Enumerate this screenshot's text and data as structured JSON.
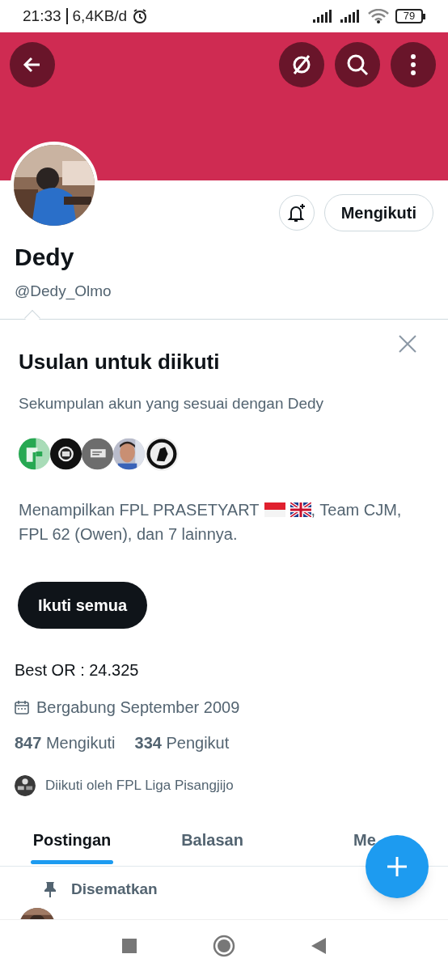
{
  "status_bar": {
    "time": "21:33",
    "speed": "6,4KB/d",
    "battery": "79"
  },
  "header": {
    "buttons": [
      {
        "kind": "back"
      },
      {
        "kind": "grok"
      },
      {
        "kind": "search"
      },
      {
        "kind": "more"
      }
    ]
  },
  "profile": {
    "name": "Dedy",
    "handle": "@Dedy_Olmo",
    "follow_button": "Mengikuti",
    "bio": "Best OR : 24.325",
    "joined": "Bergabung September 2009",
    "stats": [
      {
        "text": "**847** Mengikuti"
      },
      {
        "text": "**334** Pengikut"
      }
    ],
    "followed_by": "Diikuti oleh FPL Liga Pisangjijo"
  },
  "suggestions": {
    "title": "Usulan untuk diikuti",
    "subtitle": "Sekumpulan akun yang sesuai dengan Dedy",
    "summary_before": "Menampilkan FPL PRASETYART",
    "flags": [
      {
        "kind": "indonesia"
      },
      {
        "kind": "uk"
      }
    ],
    "summary_middle": ", Team CJM,",
    "summary_end": "FPL 62 (Owen), dan 7 lainnya.",
    "follow_all": "Ikuti semua"
  },
  "tabs": [
    {
      "label": "Postingan",
      "selected": true
    },
    {
      "label": "Balasan",
      "selected": false
    },
    {
      "label": "Me",
      "selected": false
    }
  ],
  "pinned": "Disematkan",
  "nav_bar": [
    {
      "kind": "recents"
    },
    {
      "kind": "home"
    },
    {
      "kind": "back"
    }
  ]
}
